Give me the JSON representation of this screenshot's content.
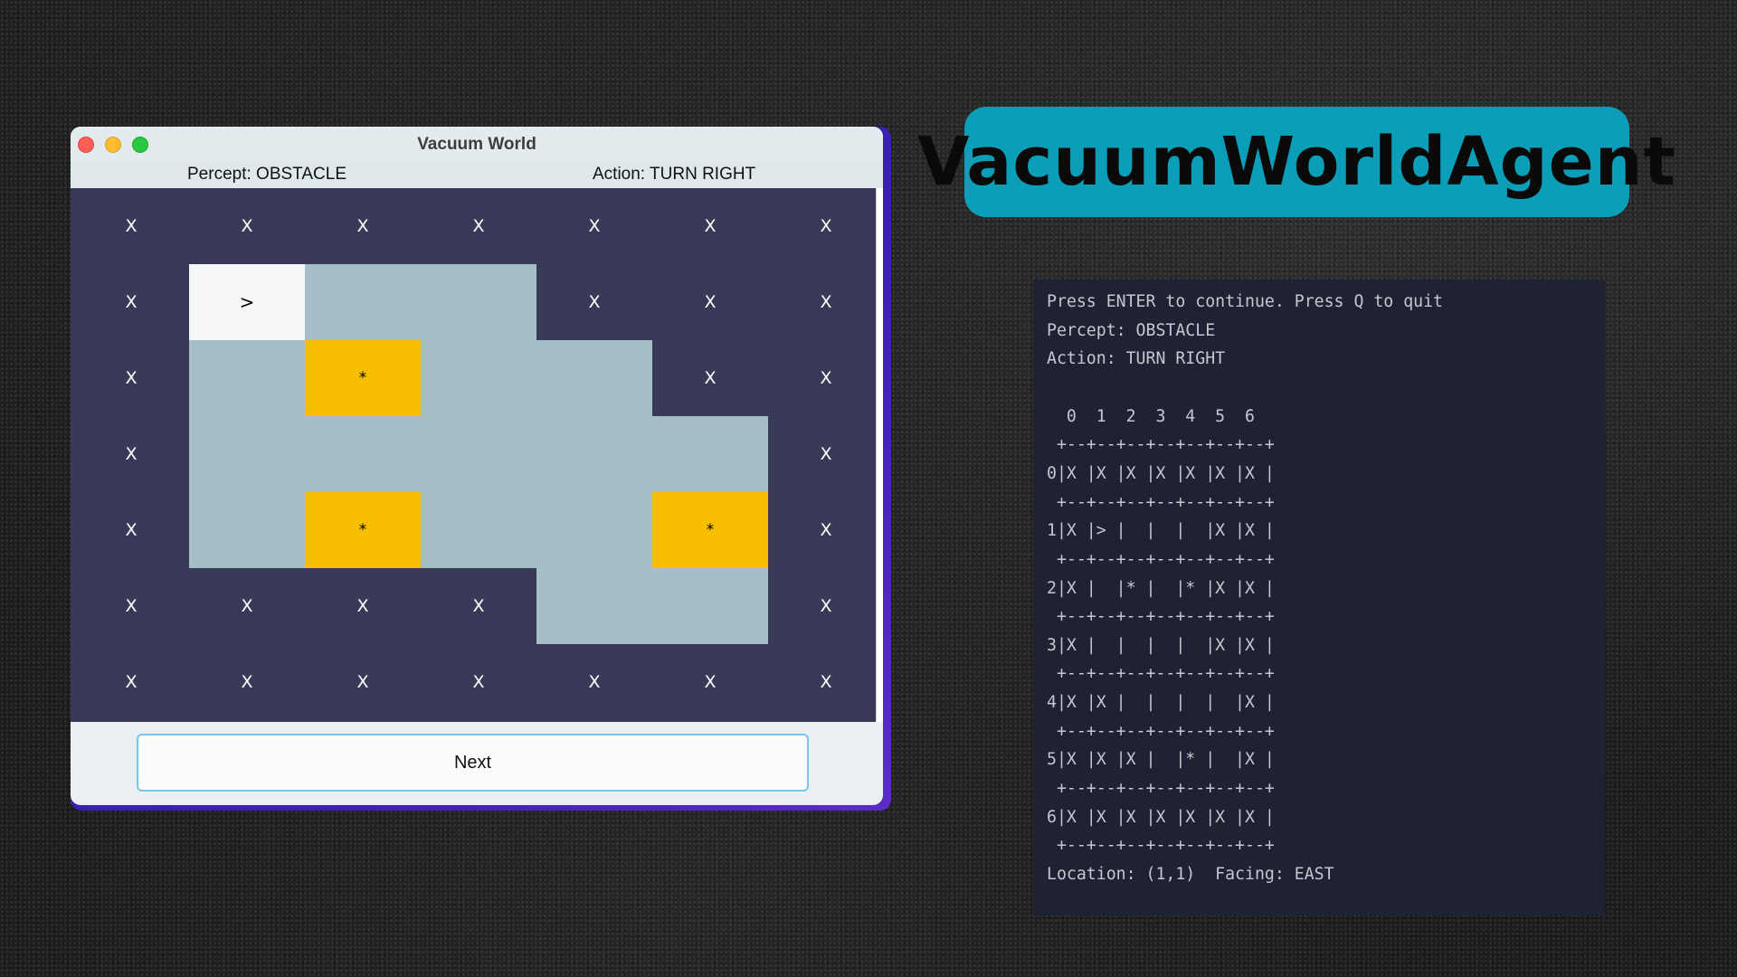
{
  "window": {
    "title": "Vacuum World",
    "percept_label": "Percept: OBSTACLE",
    "action_label": "Action: TURN RIGHT",
    "next_label": "Next"
  },
  "grid": {
    "rows": [
      [
        "X",
        "X",
        "X",
        "X",
        "X",
        "X",
        "X"
      ],
      [
        "X",
        ">",
        "",
        "",
        "X",
        "X",
        "X"
      ],
      [
        "X",
        "",
        "*",
        "",
        "",
        "X",
        "X"
      ],
      [
        "X",
        "",
        "",
        "",
        "",
        "",
        "X"
      ],
      [
        "X",
        "",
        "*",
        "",
        "",
        "*",
        "X"
      ],
      [
        "X",
        "X",
        "X",
        "X",
        "",
        "",
        "X"
      ],
      [
        "X",
        "X",
        "X",
        "X",
        "X",
        "X",
        "X"
      ]
    ],
    "agent_symbol": ">",
    "dirt_symbol": "*",
    "obstacle_symbol": "X"
  },
  "colors": {
    "obstacle": "#383a58",
    "floor": "#a6bec7",
    "dirt": "#f8bf00",
    "agent": "#f7f8f9",
    "badge": "#0a9eb8",
    "terminal_bg": "#1e2233"
  },
  "badge": {
    "title": "VacuumWorldAgent"
  },
  "terminal": {
    "lines": [
      "Press ENTER to continue. Press Q to quit",
      "Percept: OBSTACLE",
      "Action: TURN RIGHT",
      "",
      "  0  1  2  3  4  5  6",
      " +--+--+--+--+--+--+--+",
      "0|X |X |X |X |X |X |X |",
      " +--+--+--+--+--+--+--+",
      "1|X |> |  |  |  |X |X |",
      " +--+--+--+--+--+--+--+",
      "2|X |  |* |  |* |X |X |",
      " +--+--+--+--+--+--+--+",
      "3|X |  |  |  |  |X |X |",
      " +--+--+--+--+--+--+--+",
      "4|X |X |  |  |  |  |X |",
      " +--+--+--+--+--+--+--+",
      "5|X |X |X |  |* |  |X |",
      " +--+--+--+--+--+--+--+",
      "6|X |X |X |X |X |X |X |",
      " +--+--+--+--+--+--+--+",
      "Location: (1,1)  Facing: EAST"
    ]
  }
}
